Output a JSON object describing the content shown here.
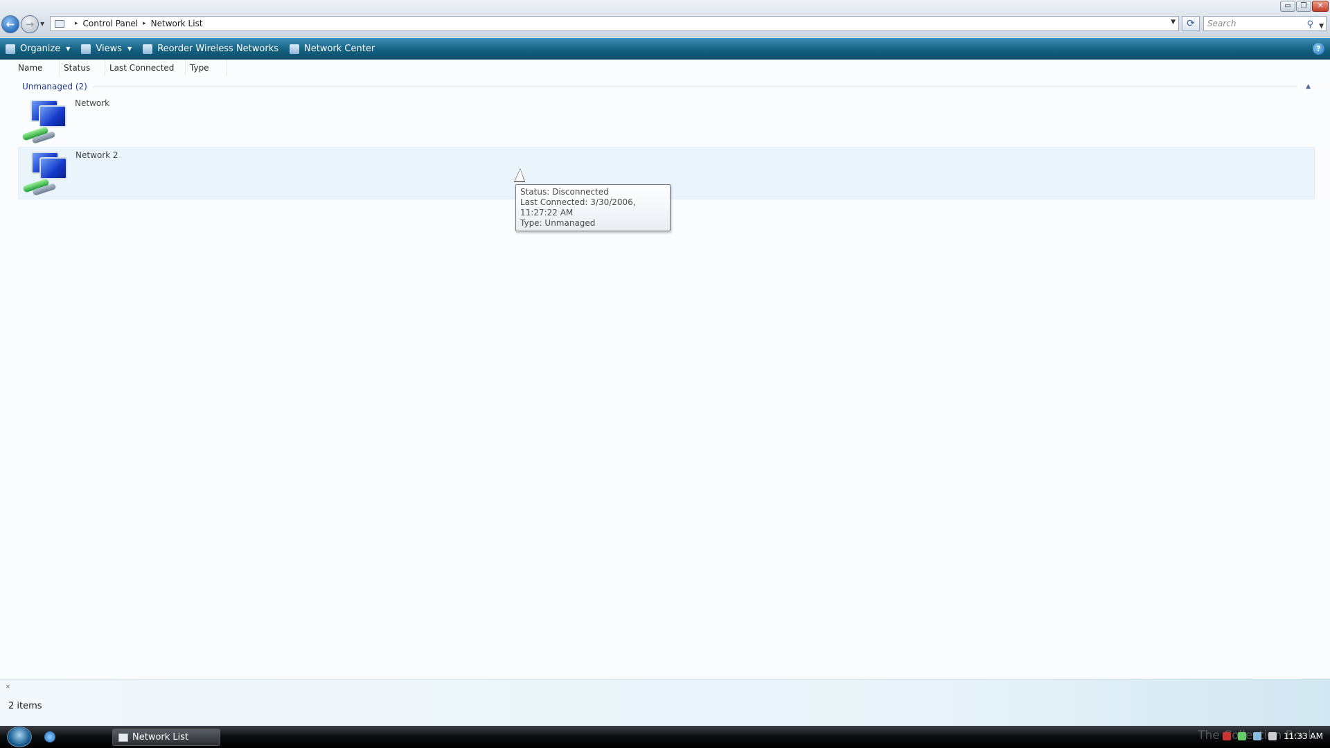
{
  "window": {
    "min_glyph": "▭",
    "max_glyph": "❐",
    "close_glyph": "✕"
  },
  "address": {
    "crumbs": [
      "Control Panel",
      "Network List"
    ],
    "search_placeholder": "Search"
  },
  "toolbar": {
    "organize": "Organize",
    "views": "Views",
    "reorder": "Reorder Wireless Networks",
    "network_center": "Network Center",
    "help": "?"
  },
  "columns": [
    "Name",
    "Status",
    "Last Connected",
    "Type"
  ],
  "group": {
    "title": "Unmanaged (2)"
  },
  "items": [
    {
      "name": "Network"
    },
    {
      "name": "Network 2"
    }
  ],
  "tooltip": {
    "status": "Status: Disconnected",
    "last_connected": "Last Connected: 3/30/2006, 11:27:22 AM",
    "type": "Type: Unmanaged"
  },
  "status_bar": {
    "count": "2 items"
  },
  "taskbar": {
    "active_window": "Network List",
    "watermark": "The Collection Book",
    "clock": "11:33 AM"
  },
  "colors": {
    "command_bar": "#13607f",
    "selection": "#eaf5fb",
    "group_title": "#1e3a8a"
  }
}
